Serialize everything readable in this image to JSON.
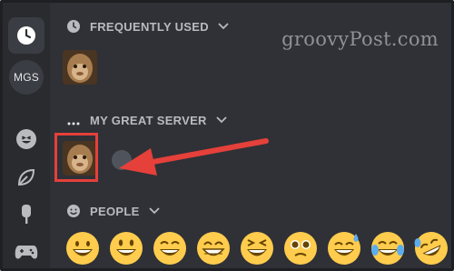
{
  "watermark": {
    "text": "groovyPost.com"
  },
  "rail": {
    "items": [
      {
        "name": "recent",
        "icon": "clock-icon"
      },
      {
        "name": "server",
        "label": "MGS"
      },
      {
        "name": "smileys",
        "icon": "smiley-icon"
      },
      {
        "name": "nature",
        "icon": "leaf-icon"
      },
      {
        "name": "food",
        "icon": "popsicle-icon"
      },
      {
        "name": "activities",
        "icon": "gamepad-icon"
      }
    ]
  },
  "sections": {
    "frequently_used": {
      "title": "FREQUENTLY USED",
      "icon": "clock-icon"
    },
    "my_great_server": {
      "title": "MY GREAT SERVER",
      "icon": "ellipsis-icon"
    },
    "people": {
      "title": "PEOPLE",
      "icon": "smiley-icon"
    }
  },
  "colors": {
    "background": "#2f3136",
    "rail": "#292b2f",
    "header_text": "#b9bbbe",
    "highlight": "#e5403a"
  },
  "emoji_people": [
    "grinning-face",
    "smiling-face-open-mouth",
    "grinning-squinting",
    "beaming-face",
    "laughing-face",
    "teary-face",
    "sweat-smile",
    "tears-of-joy",
    "rolling-laughing"
  ]
}
